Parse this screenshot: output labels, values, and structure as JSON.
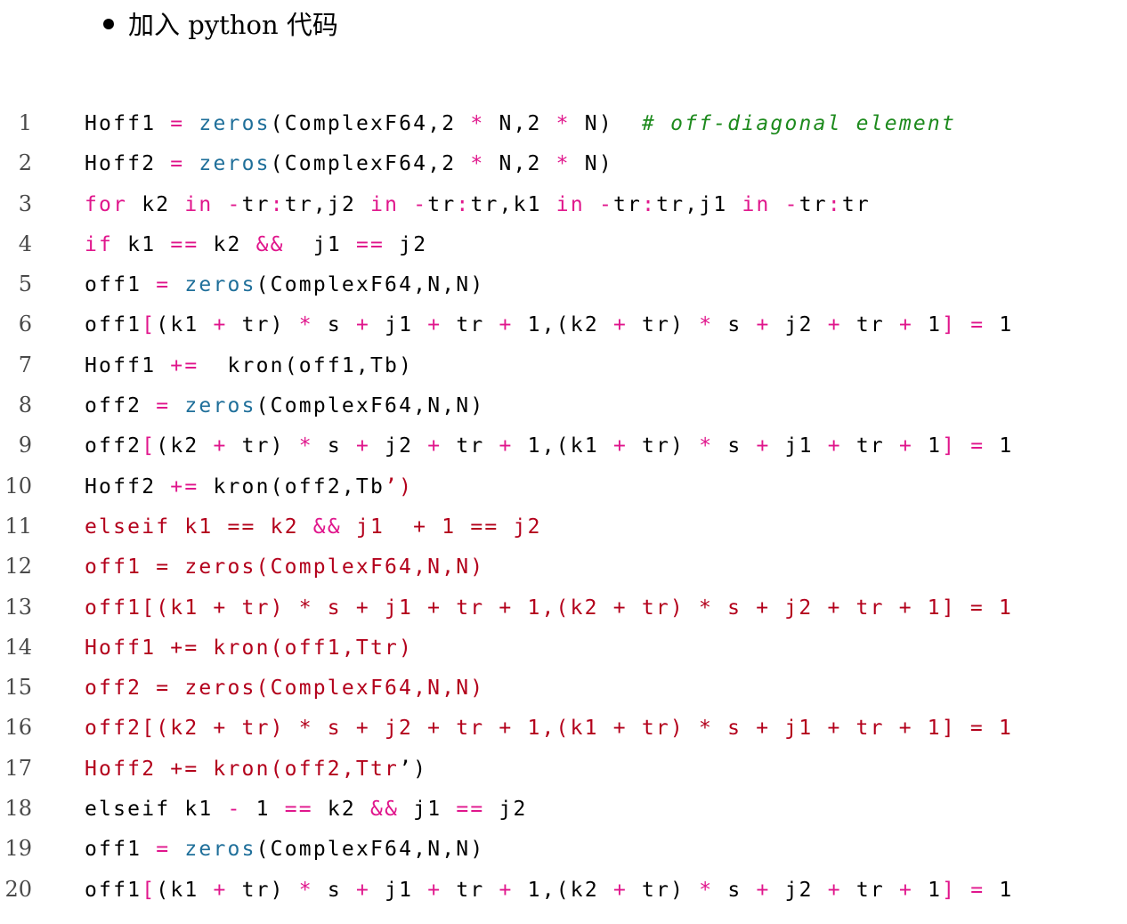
{
  "heading": {
    "bullet_text": "加入 python 代码"
  },
  "colors": {
    "operator": "#e0168c",
    "keyword": "#e0168c",
    "function": "#1f6f9a",
    "comment": "#1d8a1d",
    "string": "#b3001b",
    "text": "#000000",
    "line_number": "#4a4a4a"
  },
  "code": {
    "lines": [
      {
        "number": "1",
        "tokens": [
          {
            "t": "Hoff1 ",
            "k": "plain"
          },
          {
            "t": "=",
            "k": "op"
          },
          {
            "t": " ",
            "k": "plain"
          },
          {
            "t": "zeros",
            "k": "fn"
          },
          {
            "t": "(ComplexF64,2 ",
            "k": "plain"
          },
          {
            "t": "*",
            "k": "op"
          },
          {
            "t": " N,2 ",
            "k": "plain"
          },
          {
            "t": "*",
            "k": "op"
          },
          {
            "t": " N)  ",
            "k": "plain"
          },
          {
            "t": "# off-diagonal element",
            "k": "comment"
          }
        ]
      },
      {
        "number": "2",
        "tokens": [
          {
            "t": "Hoff2 ",
            "k": "plain"
          },
          {
            "t": "=",
            "k": "op"
          },
          {
            "t": " ",
            "k": "plain"
          },
          {
            "t": "zeros",
            "k": "fn"
          },
          {
            "t": "(ComplexF64,2 ",
            "k": "plain"
          },
          {
            "t": "*",
            "k": "op"
          },
          {
            "t": " N,2 ",
            "k": "plain"
          },
          {
            "t": "*",
            "k": "op"
          },
          {
            "t": " N)",
            "k": "plain"
          }
        ]
      },
      {
        "number": "3",
        "tokens": [
          {
            "t": "for",
            "k": "kw"
          },
          {
            "t": " k2 ",
            "k": "plain"
          },
          {
            "t": "in",
            "k": "kw"
          },
          {
            "t": " ",
            "k": "plain"
          },
          {
            "t": "-",
            "k": "op"
          },
          {
            "t": "tr",
            "k": "plain"
          },
          {
            "t": ":",
            "k": "op"
          },
          {
            "t": "tr,j2 ",
            "k": "plain"
          },
          {
            "t": "in",
            "k": "kw"
          },
          {
            "t": " ",
            "k": "plain"
          },
          {
            "t": "-",
            "k": "op"
          },
          {
            "t": "tr",
            "k": "plain"
          },
          {
            "t": ":",
            "k": "op"
          },
          {
            "t": "tr,k1 ",
            "k": "plain"
          },
          {
            "t": "in",
            "k": "kw"
          },
          {
            "t": " ",
            "k": "plain"
          },
          {
            "t": "-",
            "k": "op"
          },
          {
            "t": "tr",
            "k": "plain"
          },
          {
            "t": ":",
            "k": "op"
          },
          {
            "t": "tr,j1 ",
            "k": "plain"
          },
          {
            "t": "in",
            "k": "kw"
          },
          {
            "t": " ",
            "k": "plain"
          },
          {
            "t": "-",
            "k": "op"
          },
          {
            "t": "tr",
            "k": "plain"
          },
          {
            "t": ":",
            "k": "op"
          },
          {
            "t": "tr",
            "k": "plain"
          }
        ]
      },
      {
        "number": "4",
        "tokens": [
          {
            "t": "if",
            "k": "kw"
          },
          {
            "t": " k1 ",
            "k": "plain"
          },
          {
            "t": "==",
            "k": "op"
          },
          {
            "t": " k2 ",
            "k": "plain"
          },
          {
            "t": "&&",
            "k": "op"
          },
          {
            "t": "  j1 ",
            "k": "plain"
          },
          {
            "t": "==",
            "k": "op"
          },
          {
            "t": " j2",
            "k": "plain"
          }
        ]
      },
      {
        "number": "5",
        "tokens": [
          {
            "t": "off1 ",
            "k": "plain"
          },
          {
            "t": "=",
            "k": "op"
          },
          {
            "t": " ",
            "k": "plain"
          },
          {
            "t": "zeros",
            "k": "fn"
          },
          {
            "t": "(ComplexF64,N,N)",
            "k": "plain"
          }
        ]
      },
      {
        "number": "6",
        "tokens": [
          {
            "t": "off1",
            "k": "plain"
          },
          {
            "t": "[",
            "k": "op"
          },
          {
            "t": "(k1 ",
            "k": "plain"
          },
          {
            "t": "+",
            "k": "op"
          },
          {
            "t": " tr) ",
            "k": "plain"
          },
          {
            "t": "*",
            "k": "op"
          },
          {
            "t": " s ",
            "k": "plain"
          },
          {
            "t": "+",
            "k": "op"
          },
          {
            "t": " j1 ",
            "k": "plain"
          },
          {
            "t": "+",
            "k": "op"
          },
          {
            "t": " tr ",
            "k": "plain"
          },
          {
            "t": "+",
            "k": "op"
          },
          {
            "t": " 1,(k2 ",
            "k": "plain"
          },
          {
            "t": "+",
            "k": "op"
          },
          {
            "t": " tr) ",
            "k": "plain"
          },
          {
            "t": "*",
            "k": "op"
          },
          {
            "t": " s ",
            "k": "plain"
          },
          {
            "t": "+",
            "k": "op"
          },
          {
            "t": " j2 ",
            "k": "plain"
          },
          {
            "t": "+",
            "k": "op"
          },
          {
            "t": " tr ",
            "k": "plain"
          },
          {
            "t": "+",
            "k": "op"
          },
          {
            "t": " 1",
            "k": "plain"
          },
          {
            "t": "]",
            "k": "op"
          },
          {
            "t": " ",
            "k": "plain"
          },
          {
            "t": "=",
            "k": "op"
          },
          {
            "t": " 1",
            "k": "plain"
          }
        ]
      },
      {
        "number": "7",
        "tokens": [
          {
            "t": "Hoff1 ",
            "k": "plain"
          },
          {
            "t": "+=",
            "k": "op"
          },
          {
            "t": "  kron(off1,Tb)",
            "k": "plain"
          }
        ]
      },
      {
        "number": "8",
        "tokens": [
          {
            "t": "off2 ",
            "k": "plain"
          },
          {
            "t": "=",
            "k": "op"
          },
          {
            "t": " ",
            "k": "plain"
          },
          {
            "t": "zeros",
            "k": "fn"
          },
          {
            "t": "(ComplexF64,N,N)",
            "k": "plain"
          }
        ]
      },
      {
        "number": "9",
        "tokens": [
          {
            "t": "off2",
            "k": "plain"
          },
          {
            "t": "[",
            "k": "op"
          },
          {
            "t": "(k2 ",
            "k": "plain"
          },
          {
            "t": "+",
            "k": "op"
          },
          {
            "t": " tr) ",
            "k": "plain"
          },
          {
            "t": "*",
            "k": "op"
          },
          {
            "t": " s ",
            "k": "plain"
          },
          {
            "t": "+",
            "k": "op"
          },
          {
            "t": " j2 ",
            "k": "plain"
          },
          {
            "t": "+",
            "k": "op"
          },
          {
            "t": " tr ",
            "k": "plain"
          },
          {
            "t": "+",
            "k": "op"
          },
          {
            "t": " 1,(k1 ",
            "k": "plain"
          },
          {
            "t": "+",
            "k": "op"
          },
          {
            "t": " tr) ",
            "k": "plain"
          },
          {
            "t": "*",
            "k": "op"
          },
          {
            "t": " s ",
            "k": "plain"
          },
          {
            "t": "+",
            "k": "op"
          },
          {
            "t": " j1 ",
            "k": "plain"
          },
          {
            "t": "+",
            "k": "op"
          },
          {
            "t": " tr ",
            "k": "plain"
          },
          {
            "t": "+",
            "k": "op"
          },
          {
            "t": " 1",
            "k": "plain"
          },
          {
            "t": "]",
            "k": "op"
          },
          {
            "t": " ",
            "k": "plain"
          },
          {
            "t": "=",
            "k": "op"
          },
          {
            "t": " 1",
            "k": "plain"
          }
        ]
      },
      {
        "number": "10",
        "tokens": [
          {
            "t": "Hoff2 ",
            "k": "plain"
          },
          {
            "t": "+=",
            "k": "op"
          },
          {
            "t": " kron(off2,Tb",
            "k": "plain"
          },
          {
            "t": "’)",
            "k": "str"
          }
        ]
      },
      {
        "number": "11",
        "tokens": [
          {
            "t": "elseif k1 ",
            "k": "str"
          },
          {
            "t": "==",
            "k": "str"
          },
          {
            "t": " k2 ",
            "k": "str"
          },
          {
            "t": "&&",
            "k": "op"
          },
          {
            "t": " j1  ",
            "k": "str"
          },
          {
            "t": "+",
            "k": "str"
          },
          {
            "t": " 1 ",
            "k": "str"
          },
          {
            "t": "==",
            "k": "str"
          },
          {
            "t": " j2",
            "k": "str"
          }
        ]
      },
      {
        "number": "12",
        "tokens": [
          {
            "t": "off1 = zeros(ComplexF64,N,N)",
            "k": "str"
          }
        ]
      },
      {
        "number": "13",
        "tokens": [
          {
            "t": "off1[(k1 + tr) * s + j1 + tr + 1,(k2 + tr) * s + j2 + tr + 1] = 1",
            "k": "str"
          }
        ]
      },
      {
        "number": "14",
        "tokens": [
          {
            "t": "Hoff1 += kron(off1,Ttr)",
            "k": "str"
          }
        ]
      },
      {
        "number": "15",
        "tokens": [
          {
            "t": "off2 = zeros(ComplexF64,N,N)",
            "k": "str"
          }
        ]
      },
      {
        "number": "16",
        "tokens": [
          {
            "t": "off2[(k2 + tr) * s + j2 + tr + 1,(k1 + tr) * s + j1 + tr + 1] = 1",
            "k": "str"
          }
        ]
      },
      {
        "number": "17",
        "tokens": [
          {
            "t": "Hoff2 += kron(off2,Ttr",
            "k": "str"
          },
          {
            "t": "’)",
            "k": "plain"
          }
        ]
      },
      {
        "number": "18",
        "tokens": [
          {
            "t": "elseif k1 ",
            "k": "plain"
          },
          {
            "t": "-",
            "k": "op"
          },
          {
            "t": " 1 ",
            "k": "plain"
          },
          {
            "t": "==",
            "k": "op"
          },
          {
            "t": " k2 ",
            "k": "plain"
          },
          {
            "t": "&&",
            "k": "op"
          },
          {
            "t": " j1 ",
            "k": "plain"
          },
          {
            "t": "==",
            "k": "op"
          },
          {
            "t": " j2",
            "k": "plain"
          }
        ]
      },
      {
        "number": "19",
        "tokens": [
          {
            "t": "off1 ",
            "k": "plain"
          },
          {
            "t": "=",
            "k": "op"
          },
          {
            "t": " ",
            "k": "plain"
          },
          {
            "t": "zeros",
            "k": "fn"
          },
          {
            "t": "(ComplexF64,N,N)",
            "k": "plain"
          }
        ]
      },
      {
        "number": "20",
        "tokens": [
          {
            "t": "off1",
            "k": "plain"
          },
          {
            "t": "[",
            "k": "op"
          },
          {
            "t": "(k1 ",
            "k": "plain"
          },
          {
            "t": "+",
            "k": "op"
          },
          {
            "t": " tr) ",
            "k": "plain"
          },
          {
            "t": "*",
            "k": "op"
          },
          {
            "t": " s ",
            "k": "plain"
          },
          {
            "t": "+",
            "k": "op"
          },
          {
            "t": " j1 ",
            "k": "plain"
          },
          {
            "t": "+",
            "k": "op"
          },
          {
            "t": " tr ",
            "k": "plain"
          },
          {
            "t": "+",
            "k": "op"
          },
          {
            "t": " 1,(k2 ",
            "k": "plain"
          },
          {
            "t": "+",
            "k": "op"
          },
          {
            "t": " tr) ",
            "k": "plain"
          },
          {
            "t": "*",
            "k": "op"
          },
          {
            "t": " s ",
            "k": "plain"
          },
          {
            "t": "+",
            "k": "op"
          },
          {
            "t": " j2 ",
            "k": "plain"
          },
          {
            "t": "+",
            "k": "op"
          },
          {
            "t": " tr ",
            "k": "plain"
          },
          {
            "t": "+",
            "k": "op"
          },
          {
            "t": " 1",
            "k": "plain"
          },
          {
            "t": "]",
            "k": "op"
          },
          {
            "t": " ",
            "k": "plain"
          },
          {
            "t": "=",
            "k": "op"
          },
          {
            "t": " 1",
            "k": "plain"
          }
        ]
      }
    ]
  }
}
